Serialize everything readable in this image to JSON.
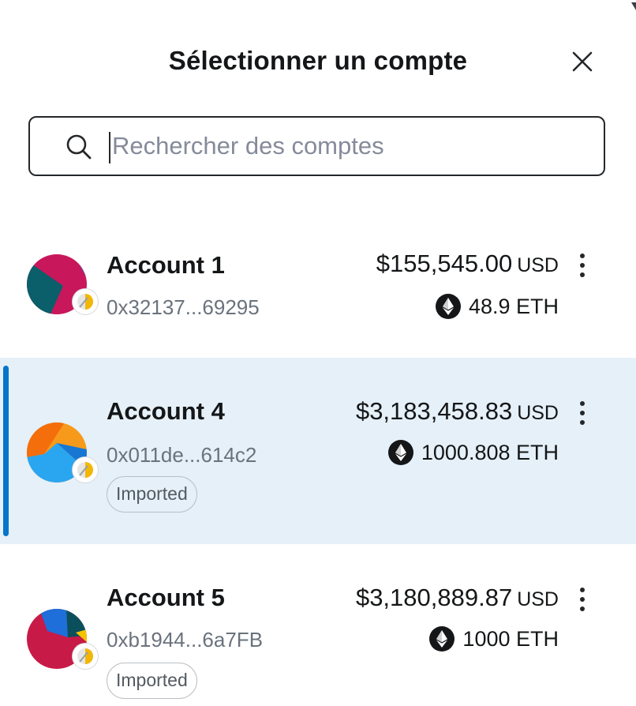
{
  "header": {
    "title": "Sélectionner un compte",
    "close_icon": "close-icon"
  },
  "search": {
    "value": "",
    "placeholder": "Rechercher des comptes",
    "icon": "search-icon"
  },
  "accounts": [
    {
      "name": "Account 1",
      "address": "0x32137...69295",
      "balance": "$155,545.00",
      "currency": "USD",
      "eth": "48.9 ETH",
      "tag": "",
      "selected": false,
      "avatar_colors": [
        "#c8175a",
        "#0a5f6b",
        "#1e88e5",
        "#f2b705"
      ]
    },
    {
      "name": "Account 4",
      "address": "0x011de...614c2",
      "balance": "$3,183,458.83",
      "currency": "USD",
      "eth": "1000.808 ETH",
      "tag": "Imported",
      "selected": true,
      "avatar_colors": [
        "#f46e0b",
        "#f79a1b",
        "#2aa6f0",
        "#1877d3"
      ]
    },
    {
      "name": "Account 5",
      "address": "0xb1944...6a7FB",
      "balance": "$3,180,889.87",
      "currency": "USD",
      "eth": "1000 ETH",
      "tag": "Imported",
      "selected": false,
      "avatar_colors": [
        "#c81a47",
        "#1e6fd9",
        "#0b4f5c",
        "#f5c400"
      ]
    }
  ],
  "colors": {
    "selected_bg": "#e5f0f8",
    "selected_bar": "#0376c9",
    "text_primary": "#141618",
    "text_muted": "#6a737d"
  }
}
